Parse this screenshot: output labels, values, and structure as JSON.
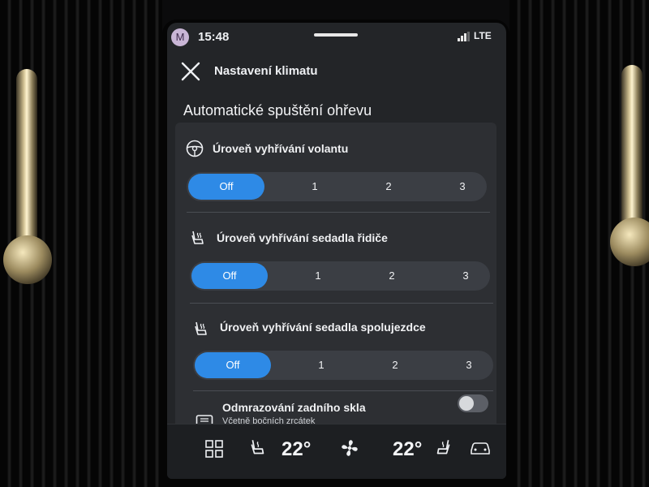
{
  "status_bar": {
    "avatar_initial": "M",
    "time": "15:48",
    "network": "LTE"
  },
  "header": {
    "title": "Nastavení klimatu",
    "close_icon": "close-icon"
  },
  "section": {
    "title": "Automatické spuštění ohřevu"
  },
  "settings": [
    {
      "icon": "steering-wheel-heat-icon",
      "label": "Úroveň vyhřívání volantu",
      "options": [
        "Off",
        "1",
        "2",
        "3"
      ],
      "selected": "Off"
    },
    {
      "icon": "driver-seat-heat-icon",
      "label": "Úroveň vyhřívání sedadla řidiče",
      "options": [
        "Off",
        "1",
        "2",
        "3"
      ],
      "selected": "Off"
    },
    {
      "icon": "passenger-seat-heat-icon",
      "label": "Úroveň vyhřívání sedadla spolujezdce",
      "options": [
        "Off",
        "1",
        "2",
        "3"
      ],
      "selected": "Off"
    }
  ],
  "rear_defrost": {
    "icon": "rear-defrost-icon",
    "label": "Odmrazování zadního skla",
    "sublabel": "Včetně bočních zrcátek",
    "enabled": false
  },
  "climate_bar": {
    "apps_icon": "grid-icon",
    "driver_seat_icon": "driver-seat-climate-icon",
    "driver_temp": "22°",
    "fan_icon": "fan-icon",
    "passenger_temp": "22°",
    "passenger_seat_icon": "passenger-seat-climate-icon",
    "car_icon": "car-icon"
  },
  "colors": {
    "accent": "#2e8ae6",
    "background": "#232528",
    "panel": "#2d2f33"
  }
}
